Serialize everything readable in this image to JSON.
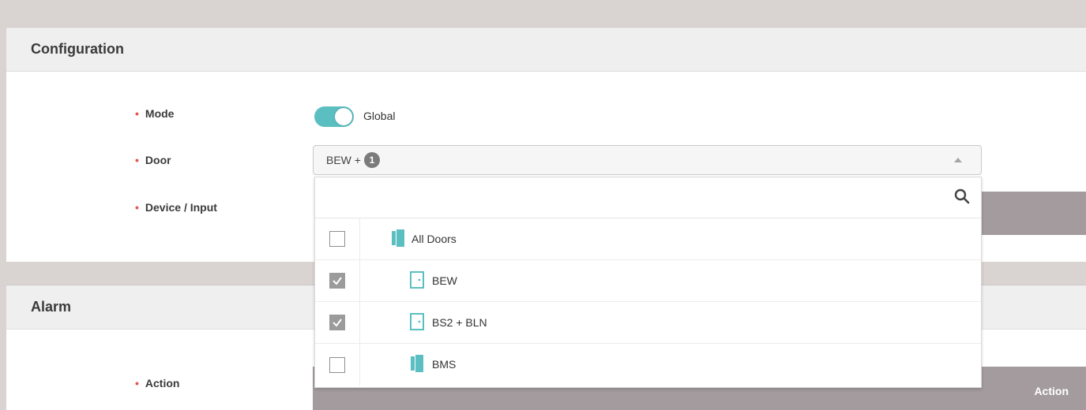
{
  "configuration": {
    "title": "Configuration",
    "mode_label": "Mode",
    "mode_value": "Global",
    "mode_on": true,
    "door_label": "Door",
    "device_input_label": "Device / Input",
    "door_select": {
      "selected_text": "BEW +",
      "extra_count": "1",
      "search_icon": "search-icon",
      "items": [
        {
          "label": "All Doors",
          "checked": false,
          "icon": "door-group-icon"
        },
        {
          "label": "BEW",
          "checked": true,
          "icon": "door-icon"
        },
        {
          "label": "BS2 + BLN",
          "checked": true,
          "icon": "door-icon"
        },
        {
          "label": "BMS",
          "checked": false,
          "icon": "door-group-icon"
        }
      ]
    }
  },
  "alarm": {
    "title": "Alarm",
    "action_label": "Action",
    "action_column_header": "Action"
  },
  "colors": {
    "accent": "#5bbfc2",
    "required": "#e1574f",
    "table_header": "#a39b9d"
  }
}
